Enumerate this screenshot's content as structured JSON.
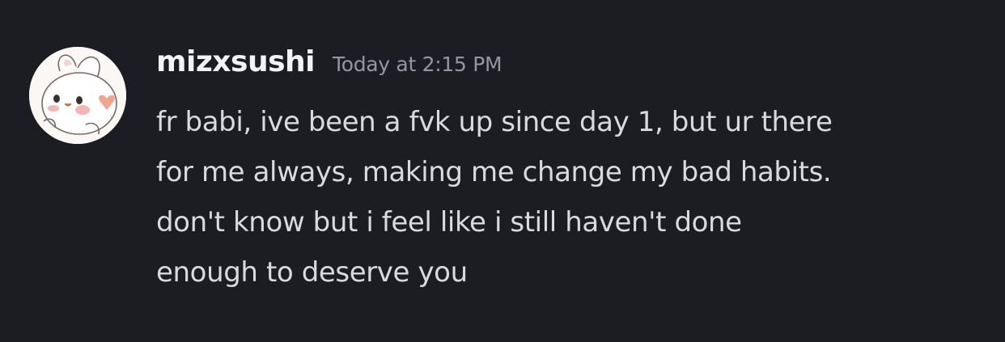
{
  "message": {
    "avatar_icon": "bunny-avatar-icon",
    "username": "mizxsushi",
    "timestamp": "Today at 2:15 PM",
    "lines": [
      "fr babi, ive been a fvk up since day 1, but ur there",
      "for me always, making me change my bad habits.",
      "don't know but i feel like i still haven't done",
      "enough to deserve you"
    ]
  },
  "colors": {
    "background": "#1c1d22",
    "username": "#f2f3f5",
    "timestamp": "#9597a0",
    "text": "#d9dadf"
  }
}
